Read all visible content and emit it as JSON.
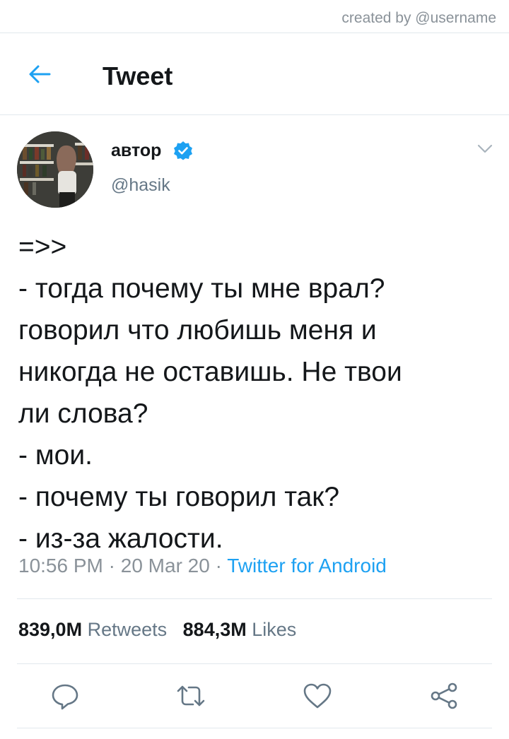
{
  "watermark": "created by @username",
  "header": {
    "title": "Tweet"
  },
  "tweet": {
    "author_name": "автор",
    "handle": "@hasik",
    "text": "=>>\n- тогда почему ты мне врал?\nговорил что любишь меня и\nникогда не оставишь. Не твои\nли слова?\n- мои.\n- почему ты говорил так?\n- из-за жалости.",
    "time": "10:56 PM",
    "date": "20 Mar 20",
    "separator": " · ",
    "source": "Twitter for Android"
  },
  "stats": {
    "retweets_count": "839,0M",
    "retweets_label": "Retweets",
    "likes_count": "884,3M",
    "likes_label": "Likes"
  },
  "icons": [
    "back-arrow-icon",
    "verified-badge-icon",
    "chevron-down-icon",
    "reply-icon",
    "retweet-icon",
    "like-icon",
    "share-icon"
  ],
  "colors": {
    "accent": "#1da1f2",
    "secondary_text": "#657786",
    "divider": "#e1e8ed"
  }
}
